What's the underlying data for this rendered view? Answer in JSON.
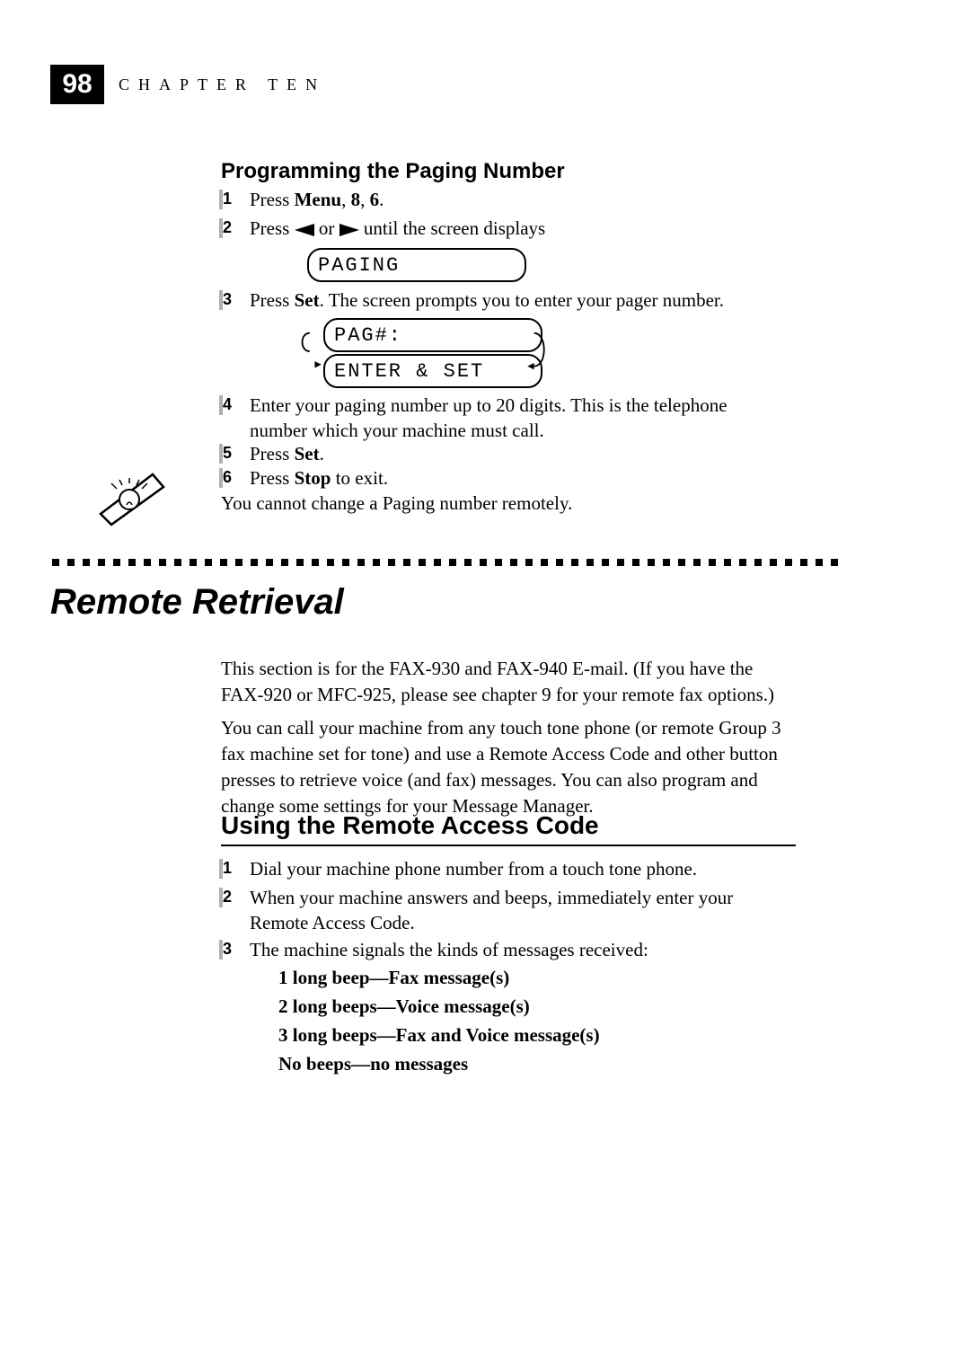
{
  "header": {
    "page_number": "98",
    "chapter_label": "CHAPTER TEN"
  },
  "section1": {
    "title": "Programming the Paging Number",
    "steps": {
      "s1": {
        "num": "1",
        "a": "Press ",
        "b": "Menu",
        "c": ", ",
        "d": "8",
        "e": ", ",
        "f": "6",
        "g": "."
      },
      "s2": {
        "num": "2",
        "a": "Press ",
        "b": " or ",
        "c": " until the screen displays"
      },
      "s3": {
        "num": "3",
        "a": "Press ",
        "b": "Set",
        "c": ". The screen prompts you to enter your pager number."
      },
      "s4": {
        "num": "4",
        "text": "Enter your paging number up to 20 digits. This is the telephone number which your machine must call."
      },
      "s5": {
        "num": "5",
        "a": "Press ",
        "b": "Set",
        "c": "."
      },
      "s6": {
        "num": "6",
        "a": "Press ",
        "b": "Stop",
        "c": " to exit."
      }
    },
    "lcd1": "PAGING",
    "lcd2": "PAG#:",
    "lcd3": "ENTER & SET",
    "note": "You cannot change a Paging number remotely."
  },
  "big_title": "Remote Retrieval",
  "para1": "This section is for the FAX-930 and FAX-940 E-mail. (If you have the FAX-920 or MFC-925, please see chapter 9 for your remote fax options.)",
  "para2": "You can call your machine from any touch tone phone (or remote Group 3 fax machine set for tone) and use a Remote Access Code and other button presses to retrieve voice (and fax) messages. You can also program and change some settings for your Message Manager.",
  "section2": {
    "title": "Using the Remote Access Code",
    "steps": {
      "s1": {
        "num": "1",
        "text": "Dial your machine phone number from a touch tone phone."
      },
      "s2": {
        "num": "2",
        "text": "When your machine answers and beeps, immediately enter your Remote Access Code."
      },
      "s3": {
        "num": "3",
        "text": "The machine signals the kinds of messages received:"
      }
    },
    "signals": {
      "l1": "1 long beep—Fax message(s)",
      "l2": "2 long beeps—Voice message(s)",
      "l3": "3 long beeps—Fax and Voice message(s)",
      "l4": "No beeps—no messages"
    }
  }
}
